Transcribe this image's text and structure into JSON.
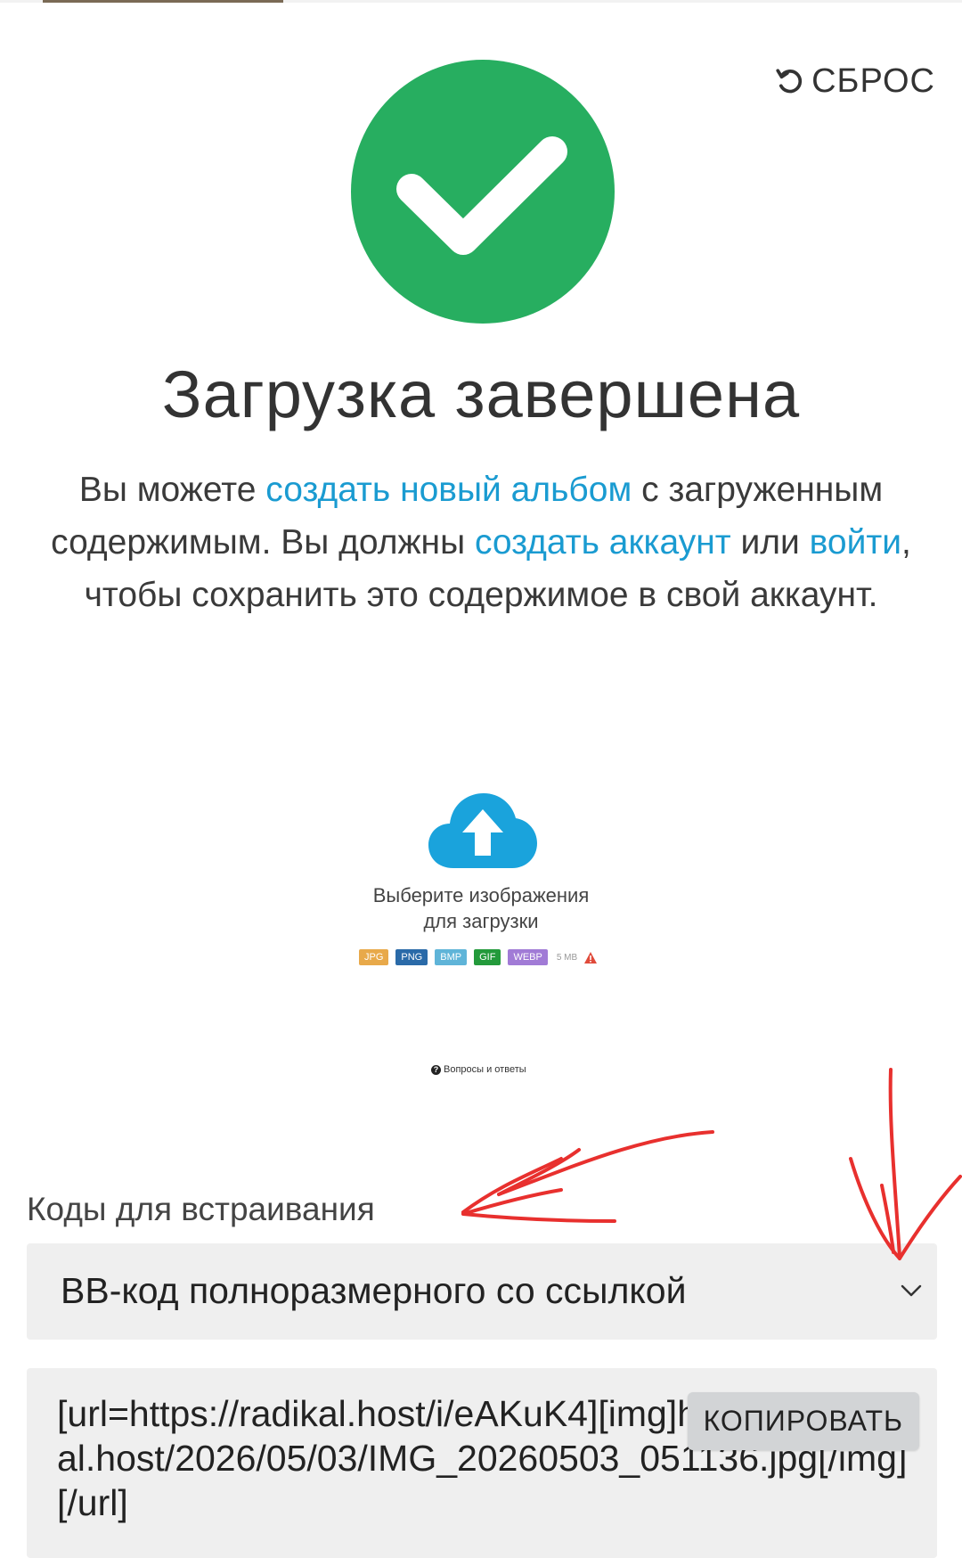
{
  "reset_label": "СБРОС",
  "title": "Загрузка завершена",
  "description": {
    "p1": "Вы можете ",
    "link_album": "создать новый альбом",
    "p2": " с загруженным содержимым. Вы должны ",
    "link_account": "создать аккаунт",
    "p3": " или ",
    "link_login": "войти",
    "p4": ", чтобы сохранить это содержимое в свой аккаунт."
  },
  "uploader": {
    "text_line1": "Выберите изображения",
    "text_line2": "для загрузки",
    "formats": [
      {
        "label": "JPG",
        "color": "#e8a94a"
      },
      {
        "label": "PNG",
        "color": "#2a6aa8"
      },
      {
        "label": "BMP",
        "color": "#5fb4d8"
      },
      {
        "label": "GIF",
        "color": "#239a3b"
      },
      {
        "label": "WEBP",
        "color": "#a17bd6"
      }
    ],
    "max_size": "5 MB"
  },
  "faq_label": "Вопросы и ответы",
  "embed": {
    "label": "Коды для встраивания",
    "selected": "BB-код полноразмерного со ссылкой",
    "code": "[url=https://radikal.host/i/eAKuK4][img]https://e.radikal.host/2026/05/03/IMG_20260503_051136.jpg[/img][/url]",
    "copy_label": "КОПИРОВАТЬ"
  },
  "colors": {
    "success": "#27ae60",
    "link": "#1a9bd1",
    "cloud": "#1aa3dc",
    "annotation": "#e8302e"
  }
}
